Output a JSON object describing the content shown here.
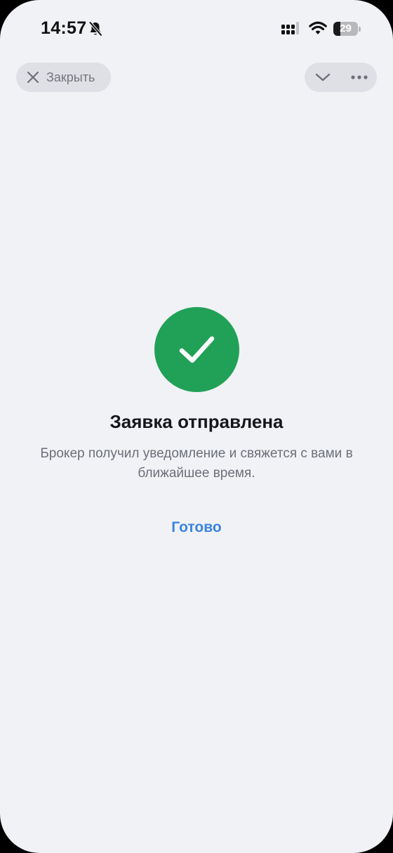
{
  "status_bar": {
    "time": "14:57",
    "battery_level": 29,
    "battery_text": "29"
  },
  "header": {
    "close_label": "Закрыть"
  },
  "result": {
    "title": "Заявка отправлена",
    "message": "Брокер получил уведомление и свяжется с вами в ближайшее время.",
    "done_label": "Готово"
  },
  "icons": {
    "bell": "bell-slash-icon",
    "signal": "signal-icon",
    "wifi": "wifi-icon",
    "close": "close-icon",
    "chevron": "chevron-down-icon",
    "more": "more-icon",
    "success": "checkmark-icon"
  },
  "colors": {
    "background": "#f1f2f6",
    "success": "#21a157",
    "link": "#3a85e0",
    "pill": "#dfe0e5"
  }
}
